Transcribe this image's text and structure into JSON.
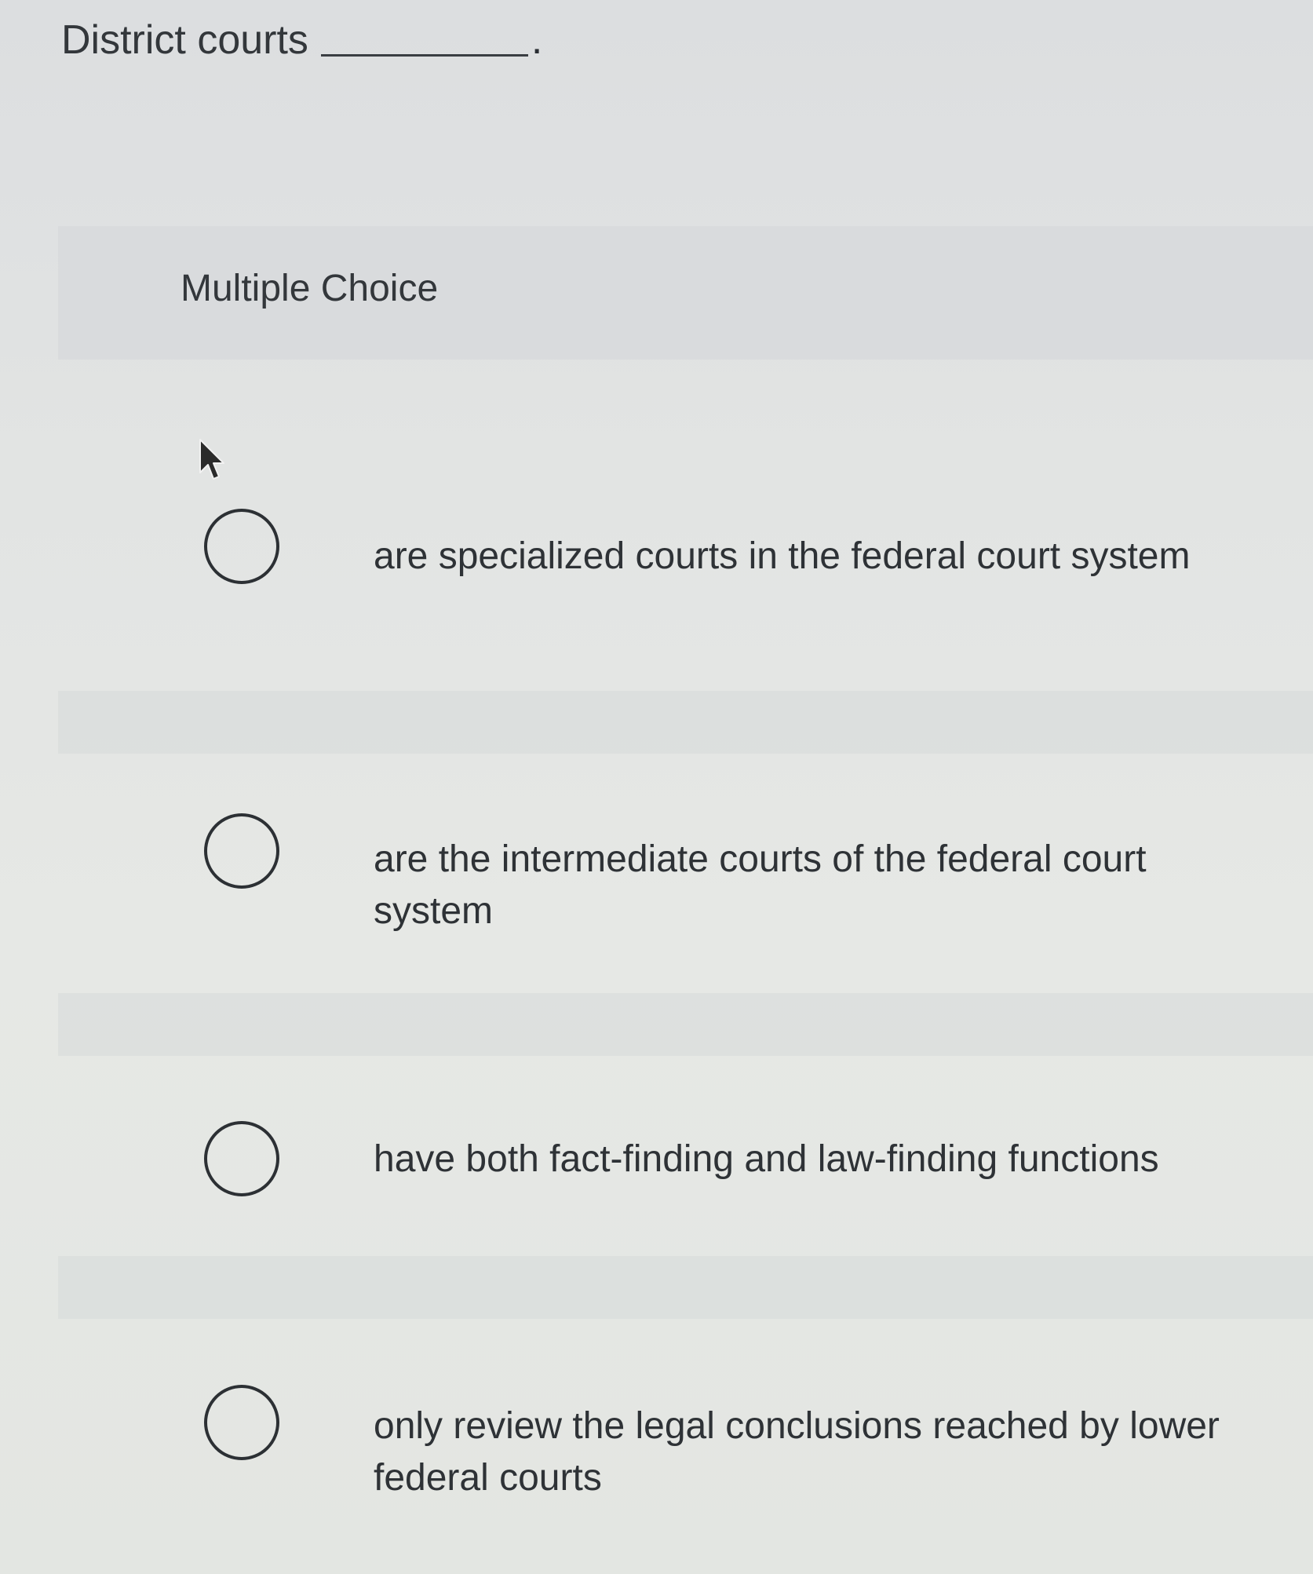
{
  "question": {
    "stem": "District courts",
    "period": "."
  },
  "panel": {
    "title": "Multiple Choice"
  },
  "options": [
    {
      "label": "are specialized courts in the federal court system",
      "selected": false
    },
    {
      "label": "are the intermediate courts of the federal court system",
      "selected": false
    },
    {
      "label": "have both fact-finding and law-finding functions",
      "selected": false
    },
    {
      "label": "only review the legal conclusions reached by lower federal courts",
      "selected": false
    }
  ],
  "icons": {
    "cursor": "mouse-pointer-icon",
    "radio": "radio-button-icon"
  }
}
